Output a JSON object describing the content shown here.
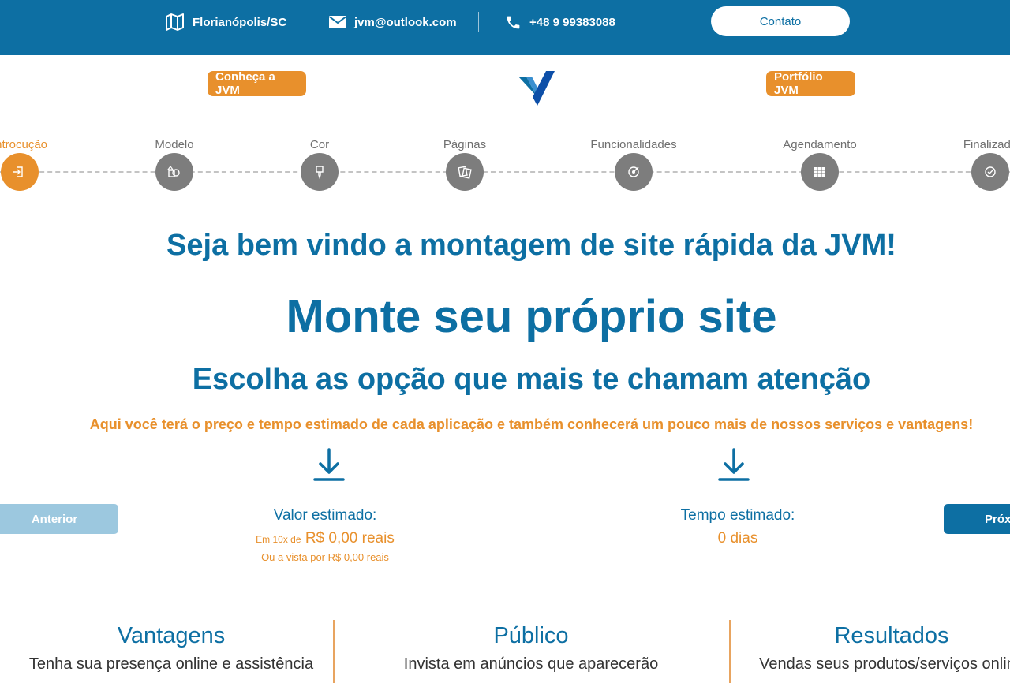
{
  "colors": {
    "primary": "#0d6fa3",
    "accent": "#e8902c",
    "step_inactive": "#7d7d7d"
  },
  "topbar": {
    "location": "Florianópolis/SC",
    "location_icon": "map-icon",
    "email": "jvm@outlook.com",
    "email_icon": "envelope-icon",
    "phone": "+48 9 99383088",
    "phone_icon": "phone-icon",
    "contact_label": "Contato"
  },
  "nav": {
    "about_label": "Conheça a JVM",
    "portfolio_label": "Portfólio JVM",
    "logo_icon": "jvm-logo-icon"
  },
  "steps": [
    {
      "label": "Introcução",
      "icon": "login-icon",
      "active": true
    },
    {
      "label": "Modelo",
      "icon": "shapes-icon",
      "active": false
    },
    {
      "label": "Cor",
      "icon": "brush-icon",
      "active": false
    },
    {
      "label": "Páginas",
      "icon": "pages-icon",
      "active": false
    },
    {
      "label": "Funcionalidades",
      "icon": "target-icon",
      "active": false
    },
    {
      "label": "Agendamento",
      "icon": "calendar-icon",
      "active": false
    },
    {
      "label": "Finalizado",
      "icon": "check-circle-icon",
      "active": false
    }
  ],
  "intro": {
    "welcome": "Seja bem vindo a montagem de site rápida da JVM!",
    "headline": "Monte seu próprio site",
    "choose": "Escolha as opção que mais te chamam atenção",
    "info": "Aqui você terá o preço e tempo estimado de cada aplicação e também conhecerá um pouco mais de nossos serviços e vantagens!"
  },
  "estimate": {
    "value_title": "Valor estimado:",
    "installments_prefix": "Em 10x de",
    "installments_value": "R$ 0,00 reais",
    "cash": "Ou a vista por R$ 0,00 reais",
    "time_title": "Tempo estimado:",
    "time_value": "0 dias",
    "arrow_icon": "arrow-down-icon"
  },
  "buttons": {
    "previous": "Anterior",
    "next": "Próximo"
  },
  "features": [
    {
      "title": "Vantagens",
      "text": "Tenha sua presença online e assistência"
    },
    {
      "title": "Público",
      "text": "Invista em anúncios que aparecerão"
    },
    {
      "title": "Resultados",
      "text": "Vendas seus produtos/serviços online"
    }
  ]
}
